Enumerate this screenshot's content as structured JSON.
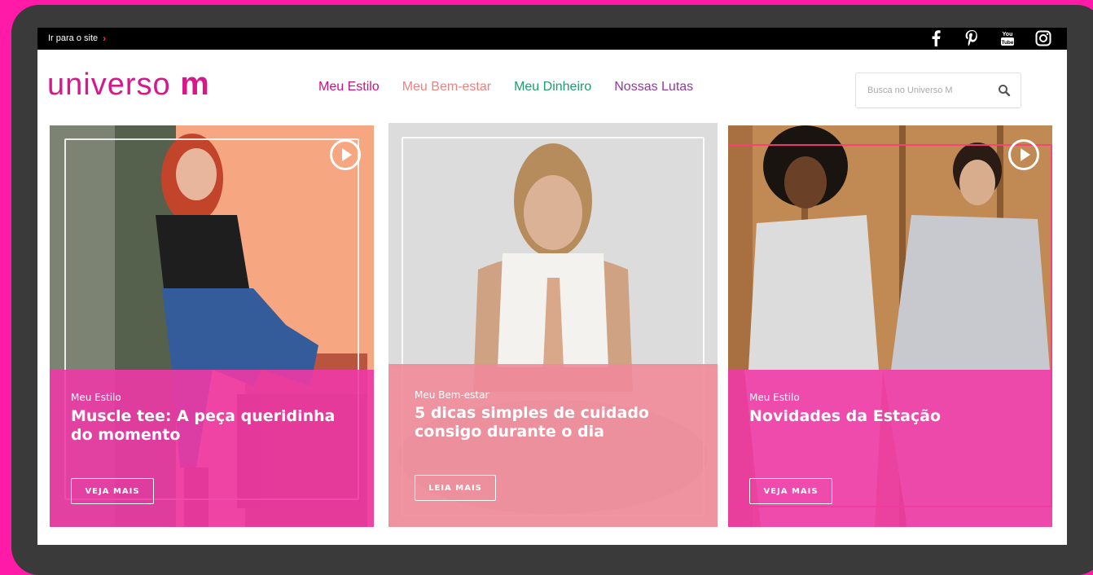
{
  "topbar": {
    "skip_label": "Ir para o site",
    "social_icons": [
      "facebook-icon",
      "pinterest-icon",
      "youtube-icon",
      "instagram-icon"
    ]
  },
  "brand": {
    "logo_text": "universo",
    "logo_mark": "m",
    "color": "#d6188a"
  },
  "nav": {
    "items": [
      {
        "label": "Meu Estilo",
        "color": "#c8137e"
      },
      {
        "label": "Meu Bem-estar",
        "color": "#f08080"
      },
      {
        "label": "Meu Dinheiro",
        "color": "#1f9d6a"
      },
      {
        "label": "Nossas Lutas",
        "color": "#8e3b9e"
      }
    ]
  },
  "search": {
    "placeholder": "Busca no Universo M",
    "value": ""
  },
  "cards": [
    {
      "category": "Meu Estilo",
      "title": "Muscle tee: A peça queridinha do momento",
      "button": "VEJA MAIS",
      "has_video": true,
      "overlay_color": "#ee3aa6"
    },
    {
      "category": "Meu Bem-estar",
      "title": "5 dicas simples de cuidado consigo durante o dia",
      "button": "LEIA MAIS",
      "has_video": false,
      "overlay_color": "#f08a9a"
    },
    {
      "category": "Meu Estilo",
      "title": "Novidades da Estação",
      "button": "VEJA MAIS",
      "has_video": true,
      "overlay_color": "#ee3aa6"
    }
  ]
}
